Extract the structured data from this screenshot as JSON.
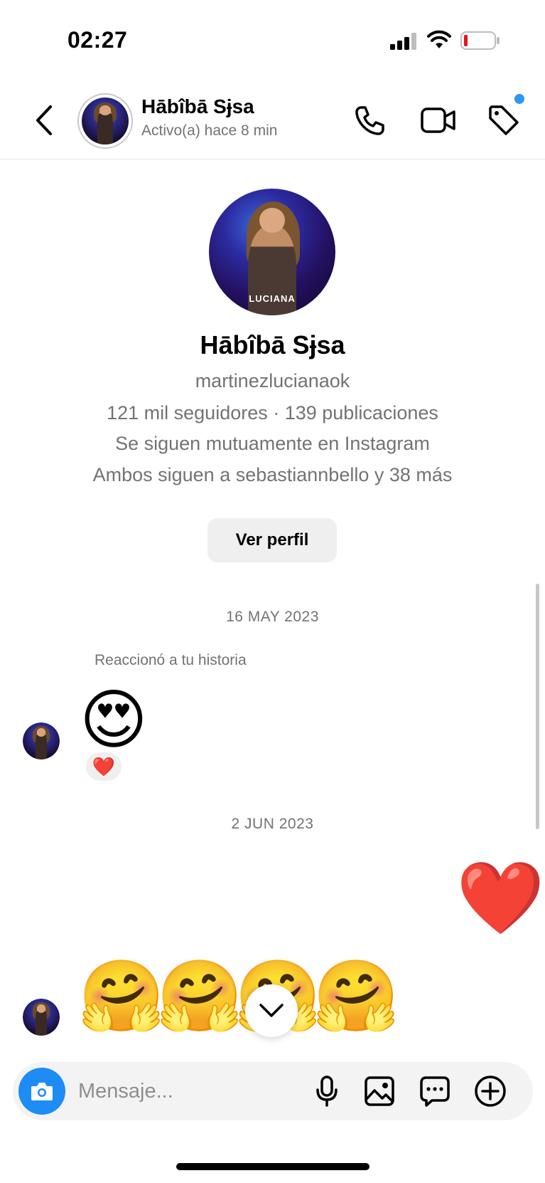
{
  "status_bar": {
    "time": "02:27"
  },
  "header": {
    "name": "Hābîbā Sɉsa",
    "status": "Activo(a) hace 8 min",
    "badge_color": "#2f95f6"
  },
  "profile": {
    "name": "Hābîbā Sɉsa",
    "avatar_caption": "LUCIANA",
    "username": "martinezlucianaok",
    "stats": "121 mil seguidores · 139 publicaciones",
    "mutual": "Se siguen mutuamente en Instagram",
    "common": "Ambos siguen a sebastiannbello y 38 más",
    "view_profile_label": "Ver perfil"
  },
  "chat": {
    "date_1": "16 MAY 2023",
    "story_reaction_label": "Reaccionó a tu historia",
    "story_reaction_emoji": "😍",
    "reaction_emoji": "❤️",
    "date_2": "2 JUN 2023",
    "sent_emoji": "❤️",
    "received_emojis": [
      "🤗",
      "🤗",
      "🤗",
      "🤗"
    ]
  },
  "composer": {
    "placeholder": "Mensaje...",
    "accent_color": "#1e8cf5"
  },
  "icons": [
    "back-chevron-icon",
    "phone-icon",
    "video-camera-icon",
    "tag-icon",
    "camera-icon",
    "microphone-icon",
    "gallery-icon",
    "sticker-icon",
    "plus-circle-icon",
    "chevron-down-icon"
  ]
}
